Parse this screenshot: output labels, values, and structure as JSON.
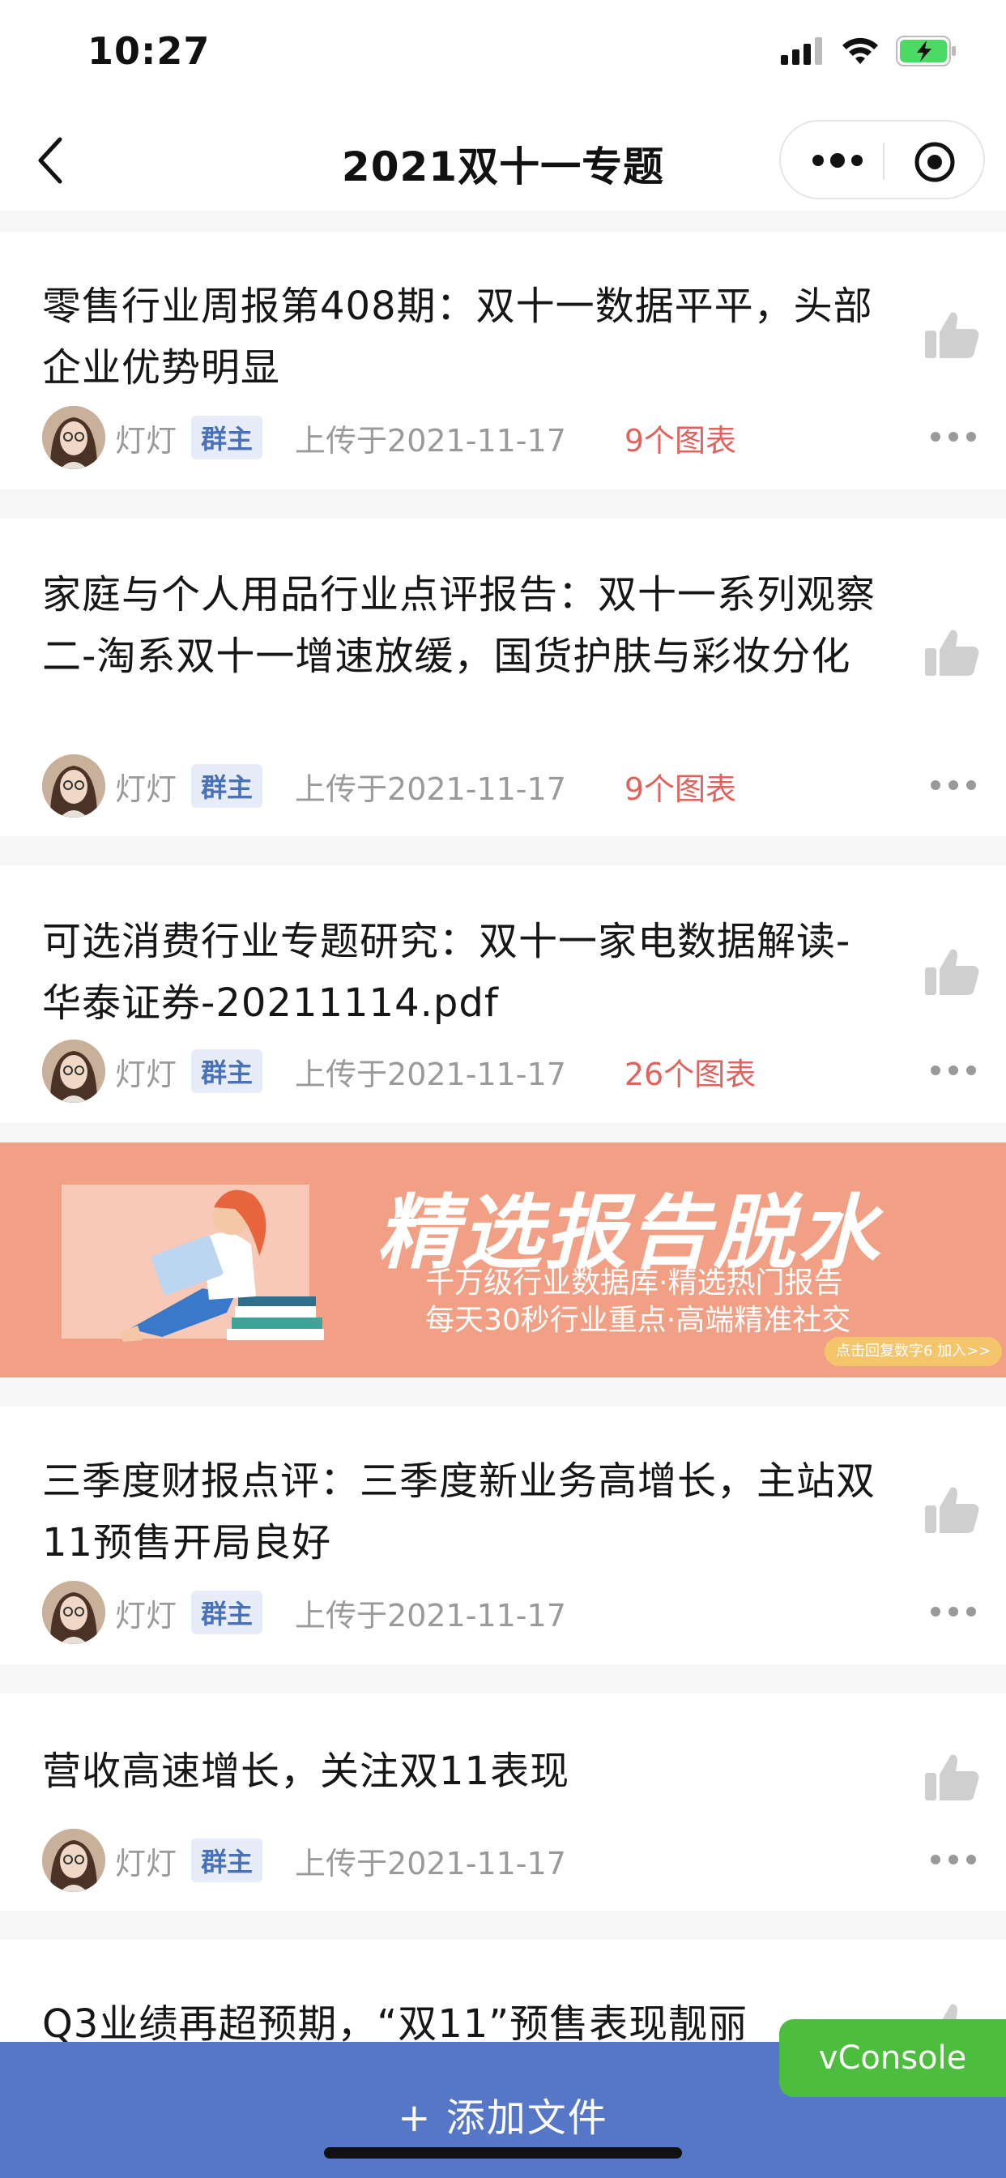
{
  "status_bar": {
    "time": "10:27"
  },
  "nav": {
    "title": "2021双十一专题"
  },
  "articles": [
    {
      "title": "零售行业周报第408期：双十一数据平平，头部企业优势明显",
      "author": "灯灯",
      "badge": "群主",
      "date": "上传于2021-11-17",
      "charts": "9个图表"
    },
    {
      "title": "家庭与个人用品行业点评报告：双十一系列观察二-淘系双十一增速放缓，国货护肤与彩妆分化",
      "author": "灯灯",
      "badge": "群主",
      "date": "上传于2021-11-17",
      "charts": "9个图表"
    },
    {
      "title": "可选消费行业专题研究：双十一家电数据解读-华泰证券-20211114.pdf",
      "author": "灯灯",
      "badge": "群主",
      "date": "上传于2021-11-17",
      "charts": "26个图表"
    },
    {
      "title": "三季度财报点评：三季度新业务高增长，主站双11预售开局良好",
      "author": "灯灯",
      "badge": "群主",
      "date": "上传于2021-11-17"
    },
    {
      "title": "营收高速增长，关注双11表现",
      "author": "灯灯",
      "badge": "群主",
      "date": "上传于2021-11-17"
    },
    {
      "title": "Q3业绩再超预期，“双11”预售表现靓丽"
    }
  ],
  "banner": {
    "headline": "精选报告脱水",
    "line1": "千万级行业数据库·精选热门报告",
    "line2": "每天30秒行业重点·高端精准社交",
    "cta": "点击回复数字6 加入>>"
  },
  "bottom": {
    "add_file": "+ 添加文件"
  },
  "vconsole": {
    "label": "vConsole"
  },
  "colors": {
    "accent": "#5677c8",
    "chart_count": "#e1615c",
    "badge_bg": "#e6edf8",
    "banner_bg": "#f1a085",
    "vconsole": "#4dbd3d"
  },
  "icons": [
    "back-icon",
    "more-icon",
    "target-icon",
    "thumbs-up-icon",
    "ellipsis-icon"
  ]
}
